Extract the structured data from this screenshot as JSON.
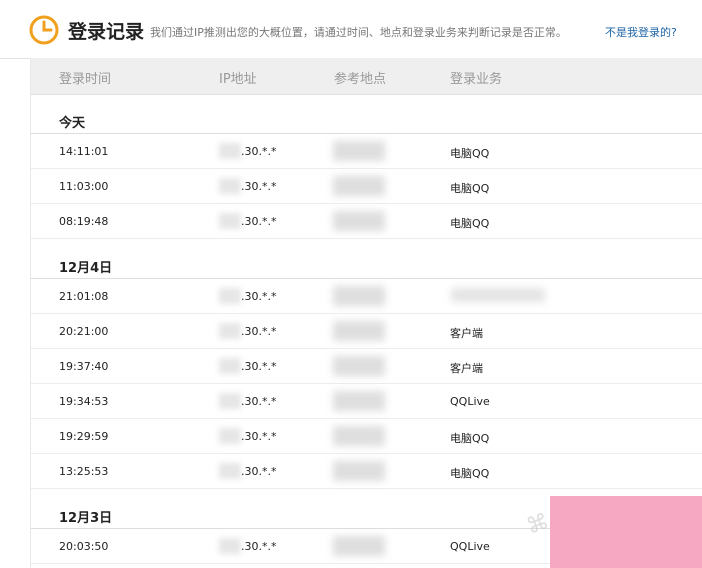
{
  "header": {
    "title": "登录记录",
    "description": "我们通过IP推测出您的大概位置，请通过时间、地点和登录业务来判断记录是否正常。",
    "link_text": "不是我登录的?"
  },
  "columns": [
    "登录时间",
    "IP地址",
    "参考地点",
    "登录业务"
  ],
  "groups": [
    {
      "label": "今天",
      "rows": [
        {
          "time": "14:11:01",
          "ip": ".30.*.*",
          "service": "电脑QQ"
        },
        {
          "time": "11:03:00",
          "ip": ".30.*.*",
          "service": "电脑QQ"
        },
        {
          "time": "08:19:48",
          "ip": ".30.*.*",
          "service": "电脑QQ"
        }
      ]
    },
    {
      "label": "12月4日",
      "rows": [
        {
          "time": "21:01:08",
          "ip": ".30.*.*",
          "service": ""
        },
        {
          "time": "20:21:00",
          "ip": ".30.*.*",
          "service": "客户端"
        },
        {
          "time": "19:37:40",
          "ip": ".30.*.*",
          "service": "客户端"
        },
        {
          "time": "19:34:53",
          "ip": ".30.*.*",
          "service": "QQLive"
        },
        {
          "time": "19:29:59",
          "ip": ".30.*.*",
          "service": "电脑QQ"
        },
        {
          "time": "13:25:53",
          "ip": ".30.*.*",
          "service": "电脑QQ"
        }
      ]
    },
    {
      "label": "12月3日",
      "rows": [
        {
          "time": "20:03:50",
          "ip": ".30.*.*",
          "service": "QQLive"
        }
      ]
    }
  ],
  "colors": {
    "accent": "#f0a01e",
    "link": "#1f65a8",
    "overlay": "#f6a7c1"
  }
}
